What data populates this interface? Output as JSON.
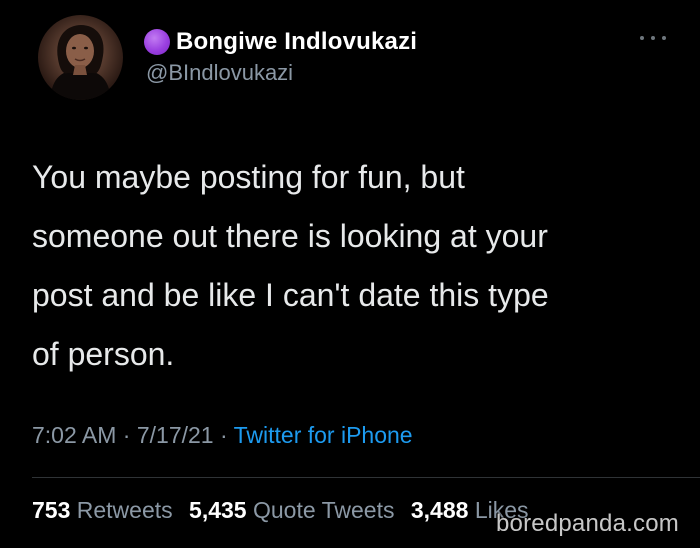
{
  "author": {
    "display_name": "Bongiwe Indlovukazi",
    "handle": "@BIndlovukazi",
    "status_color": "#9a3fe0"
  },
  "tweet": {
    "lines": [
      "You maybe posting for fun, but",
      "someone out there is looking at your",
      "post and be like I can't date this type",
      "of person."
    ],
    "time": "7:02 AM",
    "date": "7/17/21",
    "separator": " · ",
    "source": "Twitter for iPhone"
  },
  "stats": {
    "retweets_count": "753",
    "retweets_label": "Retweets",
    "quotes_count": "5,435",
    "quotes_label": "Quote Tweets",
    "likes_count": "3,488",
    "likes_label": "Likes"
  },
  "watermark": "boredpanda.com",
  "icons": {
    "more": "more-horizontal-icon",
    "status": "purple-circle-emoji-icon"
  },
  "colors": {
    "background": "#000000",
    "text": "#e7e9ea",
    "secondary": "#8b98a5",
    "link": "#1d9bf0",
    "divider": "#2f3336"
  }
}
